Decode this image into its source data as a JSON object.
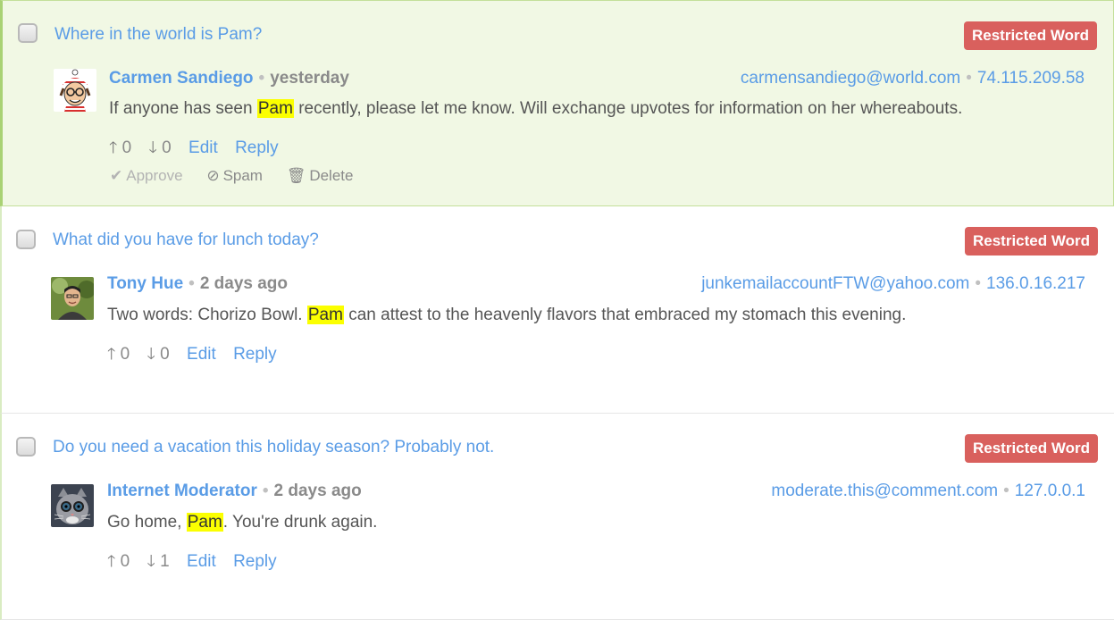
{
  "comments": [
    {
      "subject": "Where in the world is Pam?",
      "badge": "Restricted Word",
      "author": "Carmen Sandiego",
      "time": "yesterday",
      "email": "carmensandiego@world.com",
      "ip": "74.115.209.58",
      "body_before": "If anyone has seen ",
      "highlight": "Pam",
      "body_after": " recently, please let me know. Will exchange upvotes for information on her whereabouts.",
      "upvotes": "0",
      "downvotes": "0",
      "edit_label": "Edit",
      "reply_label": "Reply",
      "moderation": {
        "approve": "Approve",
        "spam": "Spam",
        "delete": "Delete"
      }
    },
    {
      "subject": "What did you have for lunch today?",
      "badge": "Restricted Word",
      "author": "Tony Hue",
      "time": "2 days ago",
      "email": "junkemailaccountFTW@yahoo.com",
      "ip": "136.0.16.217",
      "body_before": "Two words: Chorizo Bowl. ",
      "highlight": "Pam",
      "body_after": " can attest to the heavenly flavors that embraced my stomach this evening.",
      "upvotes": "0",
      "downvotes": "0",
      "edit_label": "Edit",
      "reply_label": "Reply"
    },
    {
      "subject": "Do you need a vacation this holiday season? Probably not.",
      "badge": "Restricted Word",
      "author": "Internet Moderator",
      "time": "2 days ago",
      "email": "moderate.this@comment.com",
      "ip": "127.0.0.1",
      "body_before": "Go home, ",
      "highlight": "Pam",
      "body_after": ". You're drunk again.",
      "upvotes": "0",
      "downvotes": "1",
      "edit_label": "Edit",
      "reply_label": "Reply"
    }
  ],
  "colors": {
    "link": "#5a9ce6",
    "badge": "#d9605d",
    "highlight": "#fbff00",
    "selected_bg": "#f1f8e4",
    "selected_border": "#a9d274"
  },
  "icons": {
    "upvote": "arrow-up-icon",
    "downvote": "arrow-down-icon",
    "approve": "check-icon",
    "spam": "ban-icon",
    "delete": "trash-icon"
  }
}
